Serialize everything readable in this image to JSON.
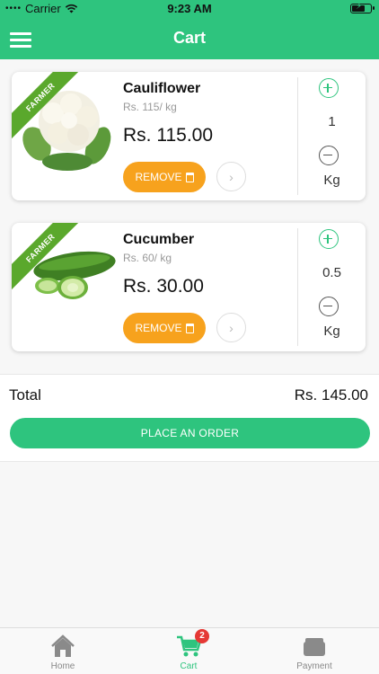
{
  "status": {
    "carrier": "Carrier",
    "time": "9:23 AM"
  },
  "header": {
    "title": "Cart"
  },
  "items": [
    {
      "name": "Cauliflower",
      "rate": "Rs. 115/ kg",
      "price": "Rs. 115.00",
      "ribbon": "FARMER",
      "remove_label": "REMOVE",
      "quantity": "1",
      "unit": "Kg"
    },
    {
      "name": "Cucumber",
      "rate": "Rs. 60/ kg",
      "price": "Rs. 30.00",
      "ribbon": "FARMER",
      "remove_label": "REMOVE",
      "quantity": "0.5",
      "unit": "Kg"
    }
  ],
  "summary": {
    "total_label": "Total",
    "total_value": "Rs. 145.00",
    "order_button": "PLACE AN ORDER"
  },
  "tabbar": {
    "home": "Home",
    "cart": "Cart",
    "cart_badge": "2",
    "payment": "Payment"
  },
  "colors": {
    "primary": "#2ec47e",
    "remove": "#f7a21d",
    "ribbon": "#5aa82c",
    "badge": "#e53935"
  }
}
